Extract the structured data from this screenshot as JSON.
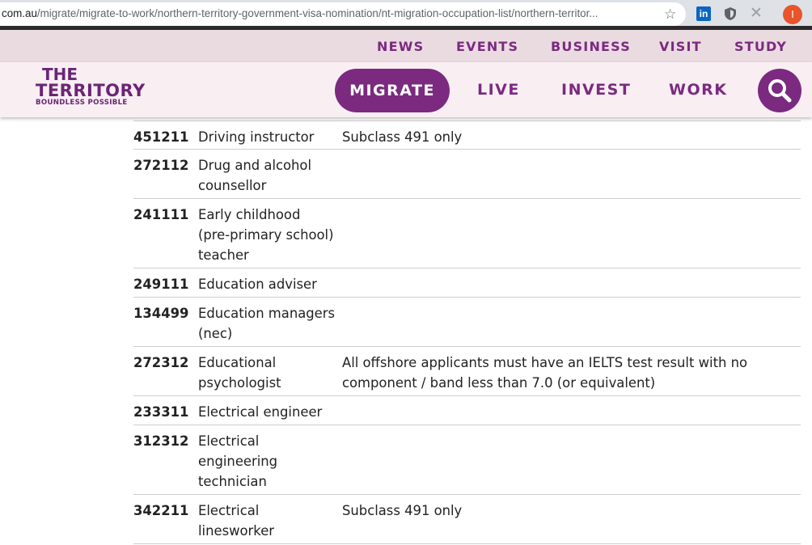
{
  "browser": {
    "url_host": "com.au",
    "url_path": "/migrate/migrate-to-work/northern-territory-government-visa-nomination/nt-migration-occupation-list/northern-territor...",
    "profile_initial": "I",
    "extensions": [
      "linkedin-extension-icon",
      "shield-extension-icon",
      "x-extension-icon"
    ]
  },
  "topnav": {
    "news": "NEWS",
    "events": "EVENTS",
    "business": "BUSINESS",
    "visit": "VISIT",
    "study": "STUDY"
  },
  "logo": {
    "line1": "THE",
    "line2": "TERRITORY",
    "line3": "BOUNDLESS POSSIBLE"
  },
  "mainnav": {
    "migrate": "MIGRATE",
    "live": "LIVE",
    "invest": "INVEST",
    "work": "WORK"
  },
  "colors": {
    "brand_purple": "#7b2a80",
    "topnav_bg": "#eadbe1",
    "header_bg": "#f9eff3"
  },
  "occupations": [
    {
      "code": "451211",
      "occupation": "Driving instructor",
      "note": "Subclass 491 only"
    },
    {
      "code": "272112",
      "occupation": "Drug and alcohol counsellor",
      "note": ""
    },
    {
      "code": "241111",
      "occupation": "Early childhood (pre-primary school) teacher",
      "note": ""
    },
    {
      "code": "249111",
      "occupation": "Education adviser",
      "note": ""
    },
    {
      "code": "134499",
      "occupation": "Education managers (nec)",
      "note": ""
    },
    {
      "code": "272312",
      "occupation": "Educational psychologist",
      "note": "All offshore applicants must have an IELTS test result with no component / band less than 7.0 (or equivalent)"
    },
    {
      "code": "233311",
      "occupation": "Electrical engineer",
      "note": ""
    },
    {
      "code": "312312",
      "occupation": "Electrical engineering technician",
      "note": ""
    },
    {
      "code": "342211",
      "occupation": "Electrical linesworker",
      "note": "Subclass 491 only"
    }
  ]
}
